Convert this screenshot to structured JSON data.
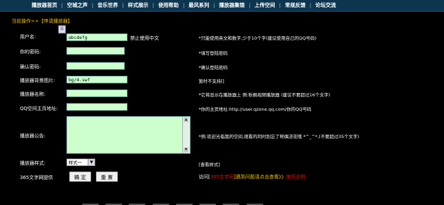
{
  "nav": {
    "items": [
      "播放器首页",
      "空城之声",
      "音乐世界",
      "样式展示",
      "使用帮助",
      "最风系列",
      "播放器集锦",
      "上传空间",
      "常规反馈",
      "论坛交流"
    ]
  },
  "breadcrumb": {
    "prefix": "当前操作>>",
    "current": "【申请播放器】"
  },
  "form": {
    "username": {
      "label": "用户名:",
      "value": "abcdefg",
      "hint": "禁止使用中文",
      "note": "*只能使用英文和数字,少于10个字(建议使用自己的QQ号码)"
    },
    "password": {
      "label": "你的密码:",
      "note": "*填写登陆密码"
    },
    "confirm": {
      "label": "确认密码:",
      "note": "*确认登陆密码"
    },
    "bg_image": {
      "label": "播放器背景图片:",
      "value": "bg/4.swf",
      "note": "暂时不支持[]"
    },
    "player_name": {
      "label": "播放器名称:",
      "note": "*它将显示在播放器上 例:秋枫视频播放器  (建议不要超过16个文字)"
    },
    "qq_home": {
      "label": "QQ空间主页地址:",
      "note": "*你的主页地址:http://user.qzone.qq.com/你的QQ号码"
    },
    "announcement": {
      "label": "播放器公告:",
      "note": "*例:欢迎光临我的空间,观看的同时别忘了帮偶浇花哦 *^_^*,(不要超过35个文字)"
    },
    "style": {
      "label": "播放器样式:",
      "selected": "样式一",
      "note": "[查看样式]"
    },
    "provider": {
      "label": "365文字网提供"
    }
  },
  "buttons": {
    "confirm": "确 定",
    "reset": "重 置"
  },
  "visit": {
    "prefix": "访问[",
    "site": "365文字网",
    "middle": "]遇到问题请点击查看》》",
    "link": "使用说明"
  },
  "colors": {
    "nav_bg": "#0d3550",
    "input_bg": "#ccffcc",
    "highlight": "#f0c000",
    "link_red": "#e01010"
  }
}
